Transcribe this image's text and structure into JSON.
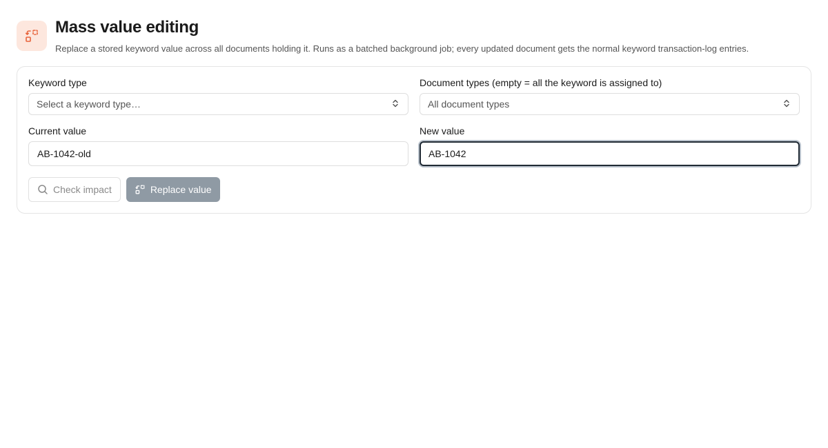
{
  "header": {
    "icon": "replace-icon",
    "title": "Mass value editing",
    "subtitle": "Replace a stored keyword value across all documents holding it. Runs as a batched background job; every updated document gets the normal keyword transaction-log entries."
  },
  "form": {
    "keyword_type": {
      "label": "Keyword type",
      "placeholder": "Select a keyword type…"
    },
    "document_types": {
      "label": "Document types (empty = all the keyword is assigned to)",
      "value": "All document types"
    },
    "current_value": {
      "label": "Current value",
      "value": "AB-1042-old"
    },
    "new_value": {
      "label": "New value",
      "value": "AB-1042"
    }
  },
  "actions": {
    "check_impact": "Check impact",
    "replace_value": "Replace value"
  },
  "colors": {
    "accent": "#e8643c",
    "accent_bg": "#fde7de",
    "primary_disabled": "#8f9aa4"
  }
}
